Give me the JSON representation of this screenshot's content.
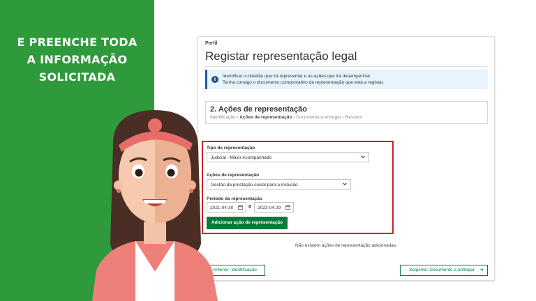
{
  "caption": {
    "line1": "E PREENCHE TODA",
    "line2": "A INFORMAÇÃO",
    "line3": "SOLICITADA"
  },
  "form": {
    "section": "Perfil",
    "title": "Registar representação legal",
    "info": {
      "line1": "Identificar o cidadão que irá representar e as ações que irá desempenhar.",
      "line2": "Tenha consigo o documento comprovativo da representação que está a registar."
    },
    "step": {
      "title": "2. Ações de representação",
      "crumbs": [
        "Identificação",
        "Ações de representação",
        "Documento a entregar",
        "Resumo"
      ],
      "crumb_sep": "›"
    },
    "tipo": {
      "label": "Tipo de representação",
      "value": "Judicial - Maior Acompanhado"
    },
    "acoes": {
      "label": "Ações de representação",
      "value": "Gestão da prestação social para a inclusão"
    },
    "periodo": {
      "label": "Período da representação",
      "start": "2021-04-30",
      "separator": "a",
      "end": "2023-04-29"
    },
    "add_button": "Adicionar ação de representação",
    "empty_message": "Não existem ações de representação adicionadas.",
    "prev_button": "Anterior: Identificação",
    "next_button": "Seguinte: Documento a entregar"
  },
  "colors": {
    "green_panel": "#2e9a3c",
    "primary_green": "#0b7a39",
    "highlight_red": "#c8232c",
    "info_blue": "#1d4f86"
  },
  "icons": [
    "info-icon",
    "chevron-down-icon",
    "calendar-icon",
    "arrow-right-icon",
    "arrow-left-icon"
  ]
}
